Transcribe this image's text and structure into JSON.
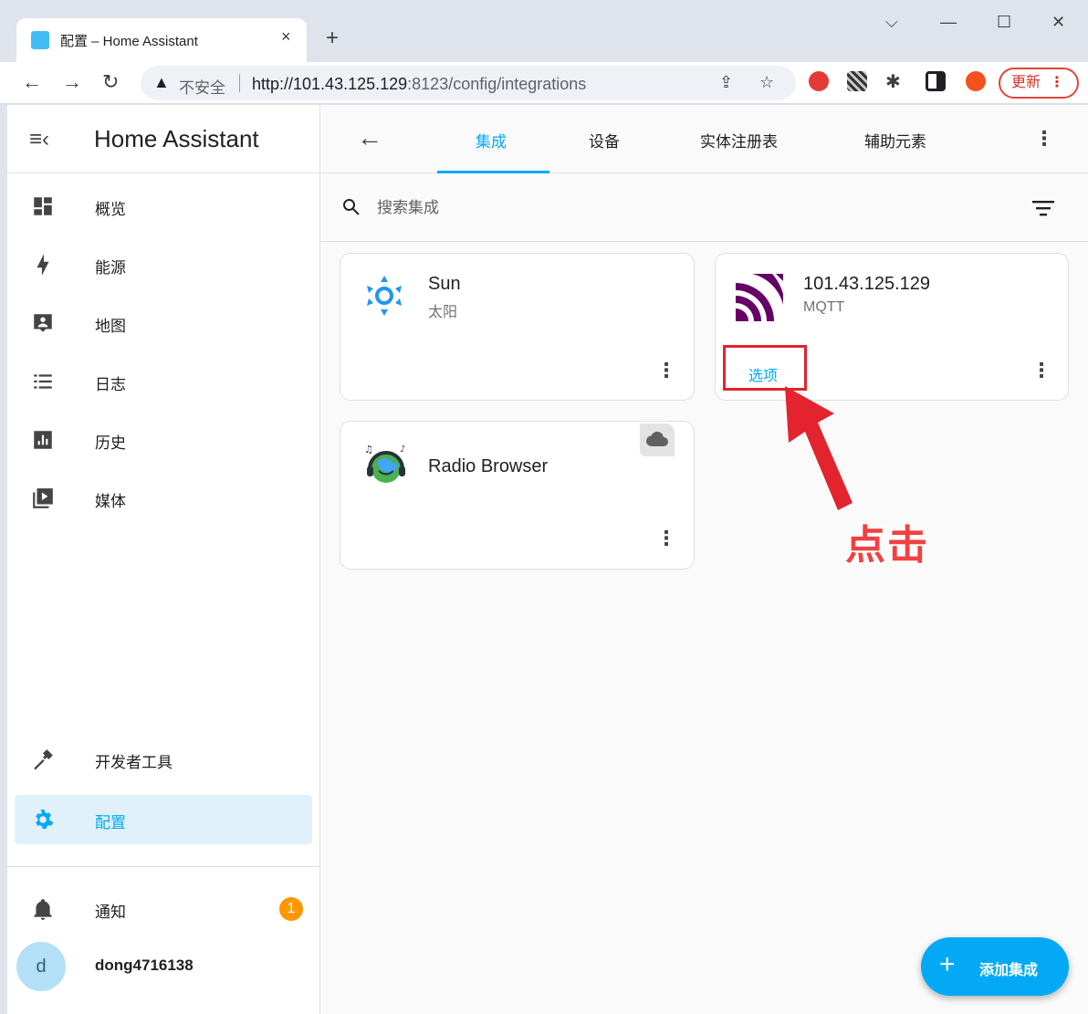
{
  "browser": {
    "tab_title": "配置 – Home Assistant",
    "tab_close": "×",
    "new_tab": "+",
    "security_label": "不安全",
    "url_host": "http://101.43.125.129",
    "url_rest": ":8123/config/integrations",
    "update_label": "更新",
    "update_menu": "⋮"
  },
  "sidebar": {
    "title": "Home Assistant",
    "items": [
      {
        "label": "概览",
        "icon": "dashboard-icon"
      },
      {
        "label": "能源",
        "icon": "lightning-bolt-icon"
      },
      {
        "label": "地图",
        "icon": "map-account-icon"
      },
      {
        "label": "日志",
        "icon": "logbook-list-icon"
      },
      {
        "label": "历史",
        "icon": "history-chart-icon"
      },
      {
        "label": "媒体",
        "icon": "media-play-icon"
      }
    ],
    "dev_tools": "开发者工具",
    "config": "配置",
    "notifications": "通知",
    "notification_count": "1",
    "avatar_initial": "d",
    "username": "dong4716138"
  },
  "topbar": {
    "tabs": [
      "集成",
      "设备",
      "实体注册表",
      "辅助元素"
    ],
    "active_tab": 0
  },
  "search": {
    "placeholder": "搜索集成"
  },
  "cards": {
    "sun": {
      "title": "Sun",
      "subtitle": "太阳"
    },
    "mqtt": {
      "title": "101.43.125.129",
      "subtitle": "MQTT",
      "options_label": "选项"
    },
    "radio": {
      "title": "Radio Browser"
    }
  },
  "annotation": {
    "text": "点击"
  },
  "fab": {
    "plus": "+",
    "label": "添加集成"
  },
  "colors": {
    "accent": "#03a9f4",
    "annotation_red": "#e3232d",
    "badge": "#ff9800",
    "mqtt_purple": "#660066"
  }
}
